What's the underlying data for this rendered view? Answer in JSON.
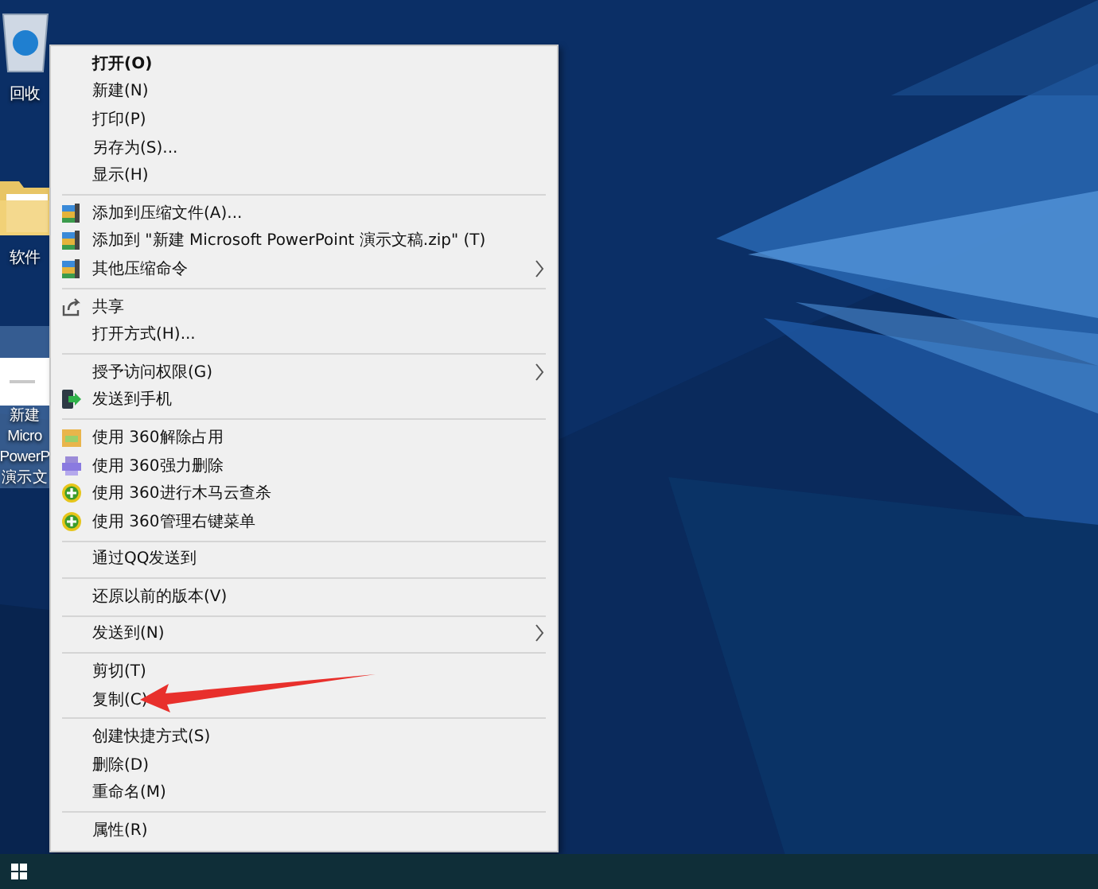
{
  "desktop_icons": [
    {
      "kind": "recycle-bin",
      "selected": false,
      "label_lines": [
        "回收"
      ]
    },
    {
      "kind": "folder",
      "selected": false,
      "label_lines": [
        "软件"
      ]
    },
    {
      "kind": "document",
      "selected": true,
      "label_lines": [
        "新建",
        "Micro",
        "PowerP",
        "演示文"
      ]
    }
  ],
  "context_menu": {
    "items": [
      {
        "kind": "plain",
        "label": "打开(O)",
        "bold": true
      },
      {
        "kind": "plain",
        "label": "新建(N)"
      },
      {
        "kind": "plain",
        "label": "打印(P)"
      },
      {
        "kind": "plain",
        "label": "另存为(S)..."
      },
      {
        "kind": "plain",
        "label": "显示(H)"
      },
      {
        "kind": "separator"
      },
      {
        "kind": "archive",
        "label": "添加到压缩文件(A)..."
      },
      {
        "kind": "archive",
        "label": "添加到 \"新建 Microsoft PowerPoint 演示文稿.zip\" (T)"
      },
      {
        "kind": "archive",
        "label": "其他压缩命令",
        "submenu": true
      },
      {
        "kind": "separator"
      },
      {
        "kind": "share",
        "label": "共享"
      },
      {
        "kind": "plain",
        "label": "打开方式(H)..."
      },
      {
        "kind": "separator"
      },
      {
        "kind": "plain",
        "label": "授予访问权限(G)",
        "submenu": true
      },
      {
        "kind": "phone",
        "label": "发送到手机"
      },
      {
        "kind": "separator"
      },
      {
        "kind": "unlock",
        "label": "使用 360解除占用"
      },
      {
        "kind": "shred",
        "label": "使用 360强力删除"
      },
      {
        "kind": "shield",
        "label": "使用 360进行木马云查杀"
      },
      {
        "kind": "shield",
        "label": "使用 360管理右键菜单"
      },
      {
        "kind": "separator"
      },
      {
        "kind": "plain",
        "label": "通过QQ发送到"
      },
      {
        "kind": "separator"
      },
      {
        "kind": "plain",
        "label": "还原以前的版本(V)"
      },
      {
        "kind": "separator"
      },
      {
        "kind": "plain",
        "label": "发送到(N)",
        "submenu": true
      },
      {
        "kind": "separator"
      },
      {
        "kind": "plain",
        "label": "剪切(T)"
      },
      {
        "kind": "plain",
        "label": "复制(C)"
      },
      {
        "kind": "separator"
      },
      {
        "kind": "plain",
        "label": "创建快捷方式(S)"
      },
      {
        "kind": "plain",
        "label": "删除(D)"
      },
      {
        "kind": "plain",
        "label": "重命名(M)"
      },
      {
        "kind": "separator"
      },
      {
        "kind": "plain",
        "label": "属性(R)"
      }
    ]
  }
}
